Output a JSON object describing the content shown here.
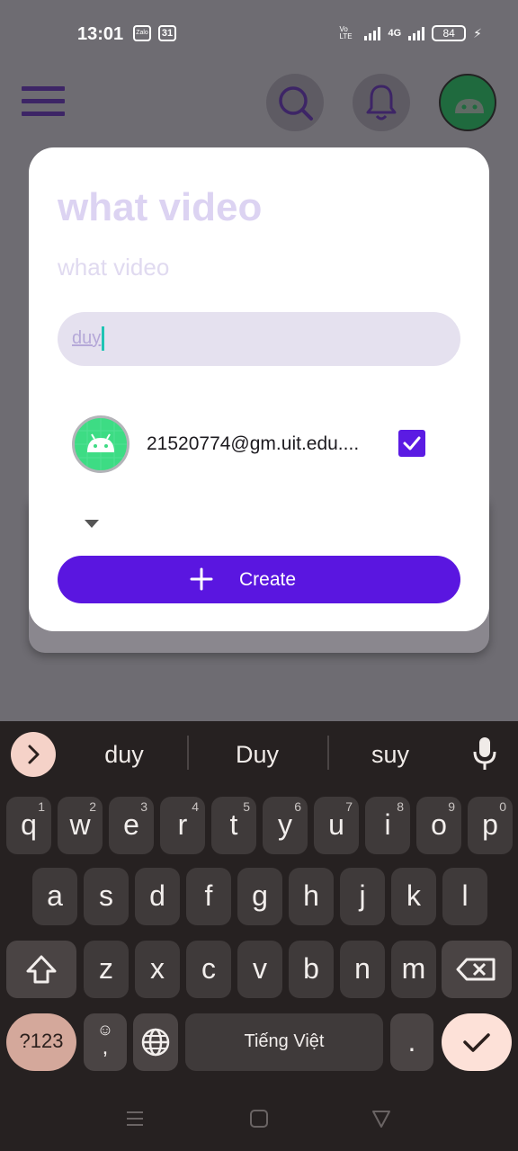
{
  "status_bar": {
    "time": "13:01",
    "left_icons": [
      "zalo-icon",
      "calendar-icon"
    ],
    "zalo": "Zalo",
    "calendar": "31",
    "volte": "Vo LTE",
    "network": "4G",
    "battery": "84"
  },
  "app_bar": {
    "menu_icon": "hamburger-icon",
    "search_icon": "search-icon",
    "notification_icon": "bell-icon",
    "avatar_icon": "android-icon"
  },
  "dialog": {
    "title": "what video",
    "subtitle": "what video",
    "search_value": "duy",
    "member": {
      "email": "21520774@gm.uit.edu....",
      "checked": true
    },
    "create_label": "Create"
  },
  "keyboard": {
    "suggestions": [
      "duy",
      "Duy",
      "suy"
    ],
    "rows": [
      [
        {
          "k": "q",
          "n": "1"
        },
        {
          "k": "w",
          "n": "2"
        },
        {
          "k": "e",
          "n": "3"
        },
        {
          "k": "r",
          "n": "4"
        },
        {
          "k": "t",
          "n": "5"
        },
        {
          "k": "y",
          "n": "6"
        },
        {
          "k": "u",
          "n": "7"
        },
        {
          "k": "i",
          "n": "8"
        },
        {
          "k": "o",
          "n": "9"
        },
        {
          "k": "p",
          "n": "0"
        }
      ],
      [
        {
          "k": "a"
        },
        {
          "k": "s"
        },
        {
          "k": "d"
        },
        {
          "k": "f"
        },
        {
          "k": "g"
        },
        {
          "k": "h"
        },
        {
          "k": "j"
        },
        {
          "k": "k"
        },
        {
          "k": "l"
        }
      ],
      [
        {
          "k": "z"
        },
        {
          "k": "x"
        },
        {
          "k": "c"
        },
        {
          "k": "v"
        },
        {
          "k": "b"
        },
        {
          "k": "n"
        },
        {
          "k": "m"
        }
      ]
    ],
    "symbols_label": "?123",
    "comma_label": ",",
    "space_label": "Tiếng Việt",
    "period_label": ".",
    "accent_color": "#d4a89b"
  },
  "colors": {
    "primary": "#5a16e0",
    "scrim": "#6e6c72",
    "keyboard_bg": "#262121"
  }
}
